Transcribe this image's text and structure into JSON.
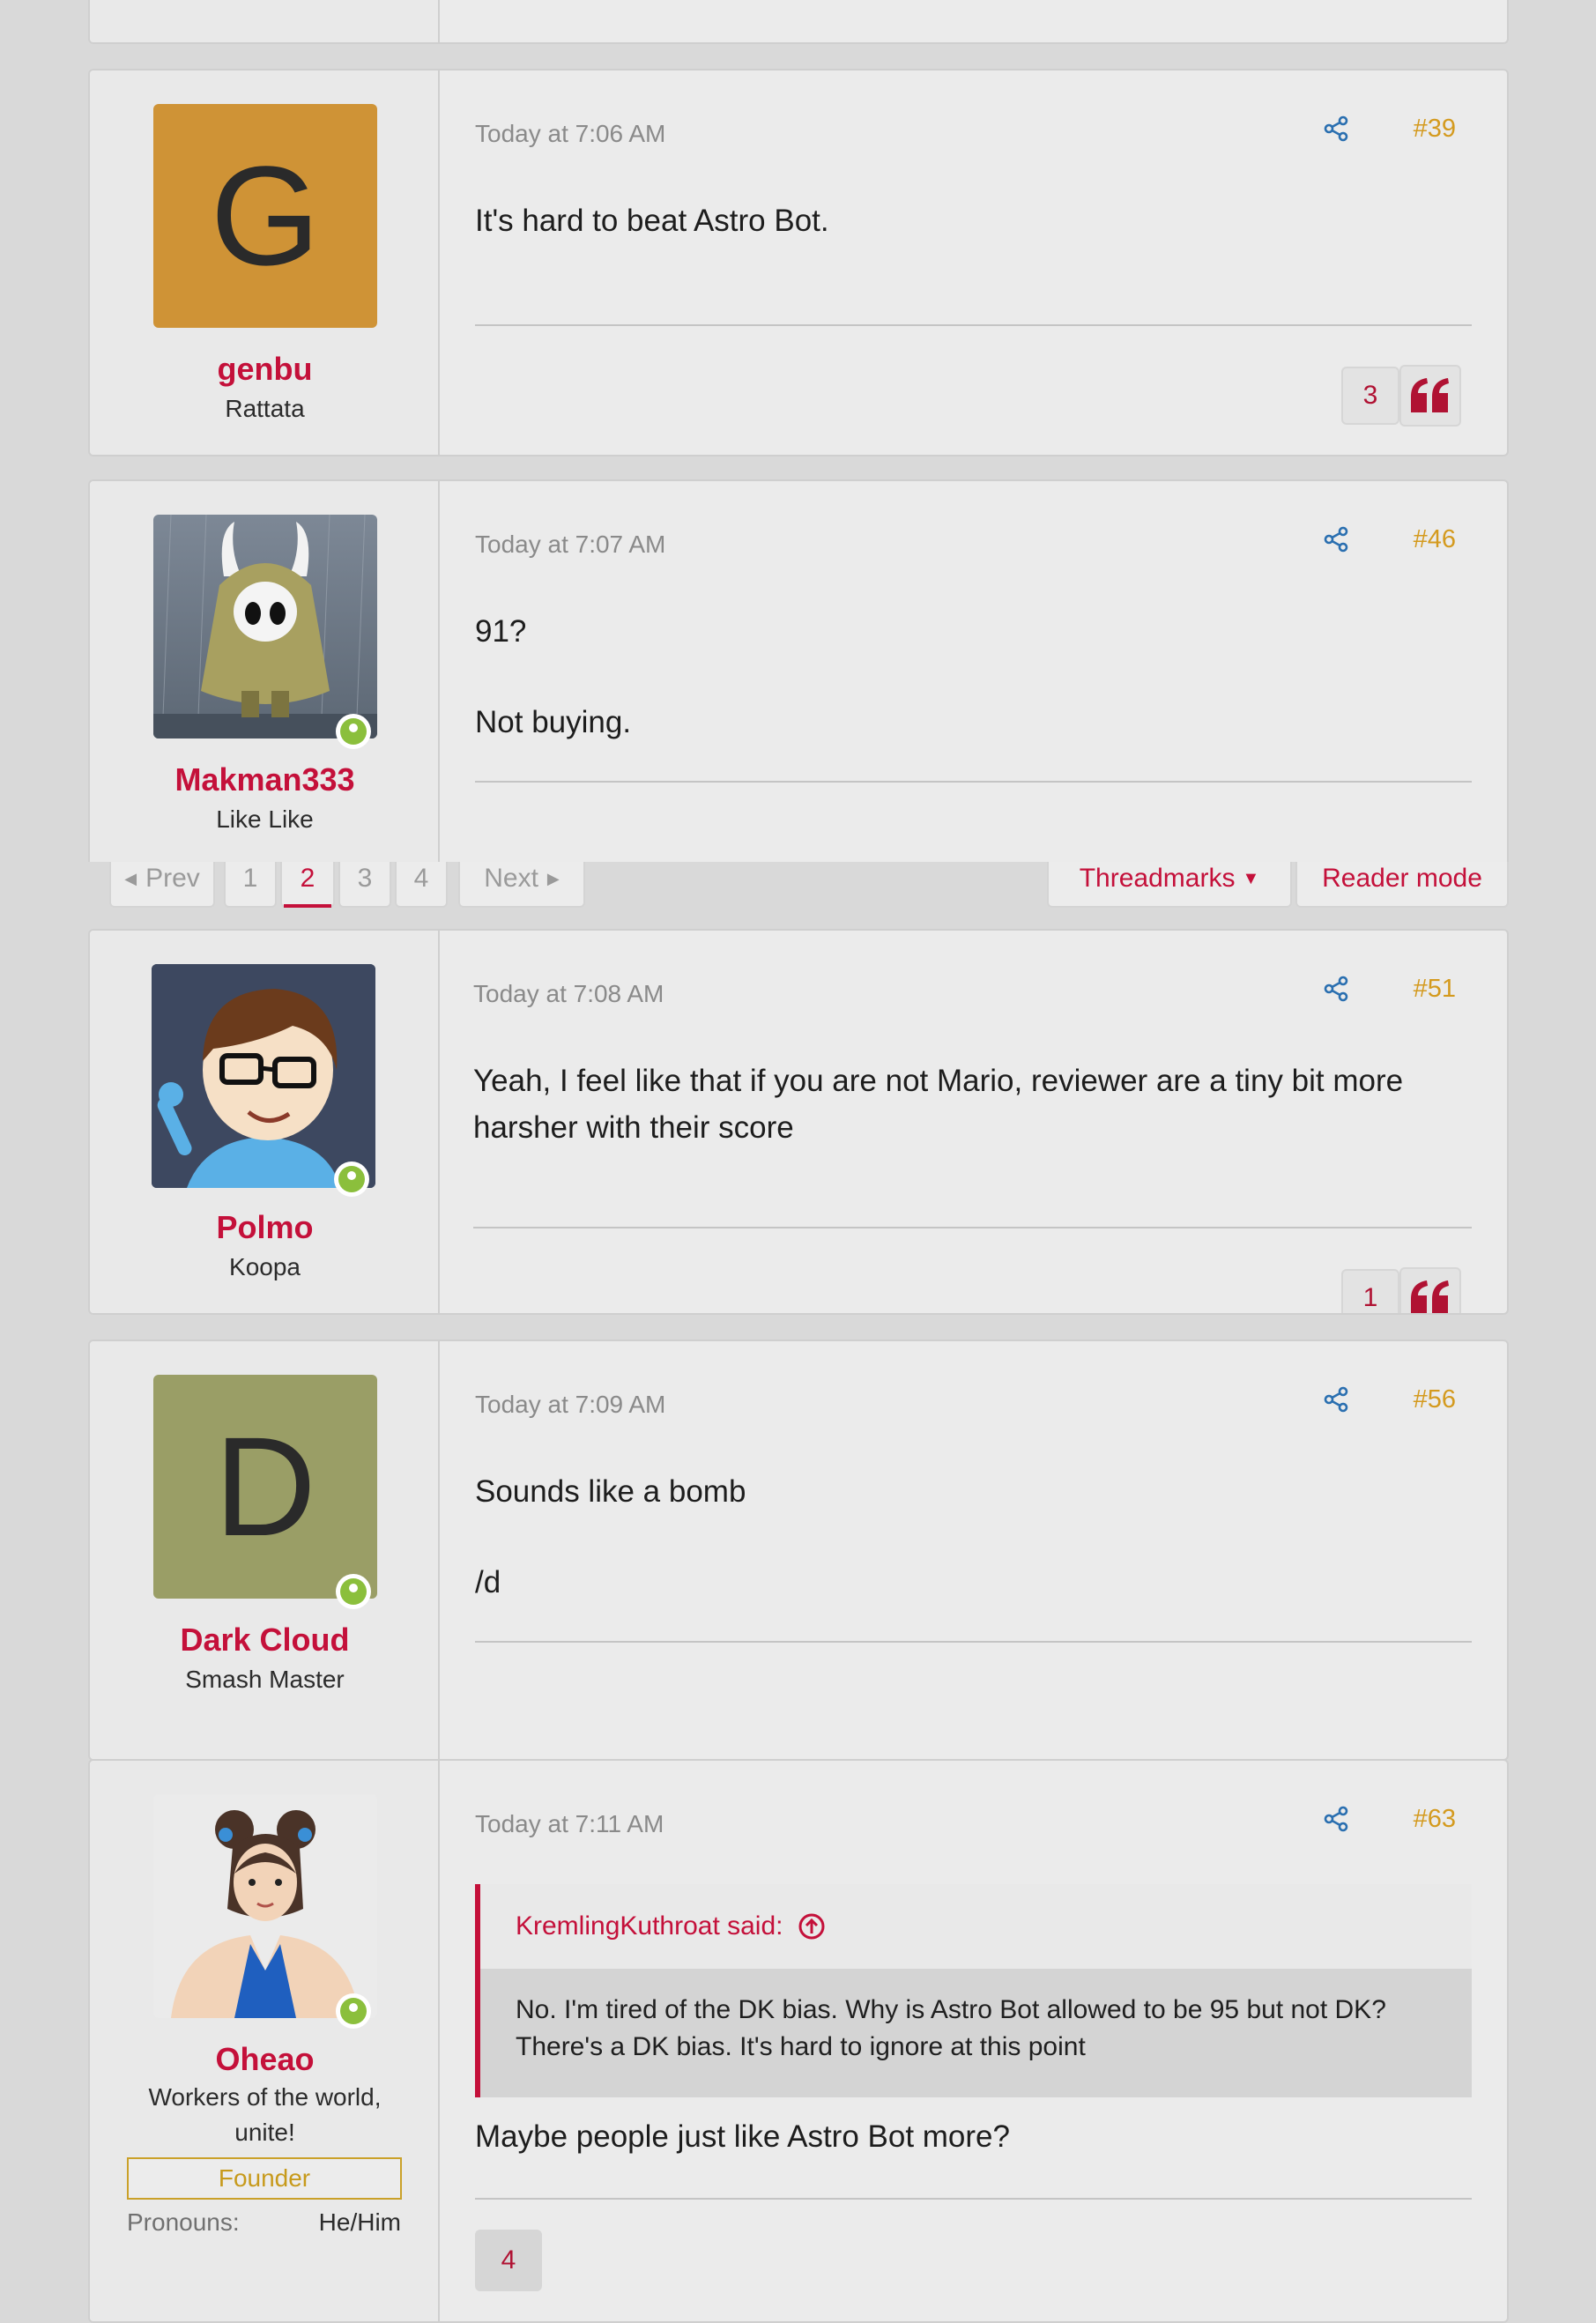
{
  "pagination": {
    "prev": "Prev",
    "pages": [
      "1",
      "2",
      "3",
      "4"
    ],
    "current": "2",
    "next": "Next",
    "threadmarks": "Threadmarks",
    "reader_mode": "Reader mode"
  },
  "posts": [
    {
      "username": "genbu",
      "user_title": "Rattata",
      "avatar_letter": "G",
      "avatar_color": "#cf9336",
      "online": false,
      "date": "Today at 7:06 AM",
      "number": "#39",
      "content": [
        "It's hard to beat Astro Bot."
      ],
      "reactions": "3"
    },
    {
      "username": "Makman333",
      "user_title": "Like Like",
      "avatar_icon": "hollow-knight-avatar",
      "online": true,
      "date": "Today at 7:07 AM",
      "number": "#46",
      "content": [
        "91?",
        "Not buying."
      ]
    },
    {
      "username": "Polmo",
      "user_title": "Koopa",
      "avatar_icon": "mii-avatar",
      "online": true,
      "date": "Today at 7:08 AM",
      "number": "#51",
      "content": [
        "Yeah, I feel like that if you are not Mario, reviewer are a tiny bit more harsher with their score"
      ],
      "reactions": "1"
    },
    {
      "username": "Dark Cloud",
      "user_title": "Smash Master",
      "avatar_letter": "D",
      "avatar_color": "#9a9e66",
      "online": true,
      "date": "Today at 7:09 AM",
      "number": "#56",
      "content": [
        "Sounds like a bomb",
        "/d"
      ]
    },
    {
      "username": "Oheao",
      "user_title": "Workers of the world, unite!",
      "badge": "Founder",
      "pronouns_label": "Pronouns:",
      "pronouns_value": "He/Him",
      "avatar_icon": "chun-li-avatar",
      "online": true,
      "date": "Today at 7:11 AM",
      "number": "#63",
      "quote_author": "KremlingKuthroat said:",
      "quote_text": "No. I'm tired of the DK bias. Why is Astro Bot allowed to be 95 but not DK? There's a DK bias. It's hard to ignore at this point",
      "content": [
        "Maybe people just like Astro Bot more?"
      ],
      "reactions": "4"
    }
  ],
  "colors": {
    "accent": "#c4103a",
    "post_number": "#d49a1e",
    "share_icon": "#2a6fb0",
    "online": "#8bbf3c",
    "founder": "#c79a1b"
  }
}
